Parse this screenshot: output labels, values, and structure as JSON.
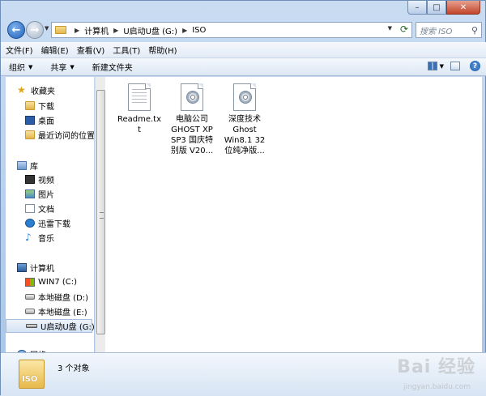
{
  "address": {
    "crumbs": [
      "计算机",
      "U启动U盘 (G:)",
      "ISO"
    ],
    "search_placeholder": "搜索 ISO"
  },
  "menu": [
    "文件(F)",
    "编辑(E)",
    "查看(V)",
    "工具(T)",
    "帮助(H)"
  ],
  "toolbar": {
    "organize": "组织",
    "share": "共享",
    "new_folder": "新建文件夹"
  },
  "nav": {
    "favorites": "收藏夹",
    "downloads": "下载",
    "desktop": "桌面",
    "recent": "最近访问的位置",
    "libraries": "库",
    "videos": "视频",
    "pictures": "图片",
    "documents": "文档",
    "xunlei": "迅雷下载",
    "music": "音乐",
    "computer": "计算机",
    "win7": "WIN7 (C:)",
    "disk_d": "本地磁盘 (D:)",
    "disk_e": "本地磁盘 (E:)",
    "usb_g": "U启动U盘 (G:)",
    "network": "网络"
  },
  "files": [
    {
      "line1": "Readme.tx",
      "line2": "t",
      "line3": "",
      "icon": "text-file"
    },
    {
      "line1": "电脑公司",
      "line2": "GHOST XP",
      "line3": "SP3 国庆特",
      "line4": "别版 V20...",
      "icon": "disc-image"
    },
    {
      "line1": "深度技术",
      "line2": "Ghost",
      "line3": "Win8.1 32",
      "line4": "位纯净版...",
      "icon": "disc-image"
    }
  ],
  "status": {
    "count": "3 个对象",
    "icon_label": "ISO"
  },
  "watermark": {
    "main": "Bai 经验",
    "sub": "jingyan.baidu.com"
  }
}
